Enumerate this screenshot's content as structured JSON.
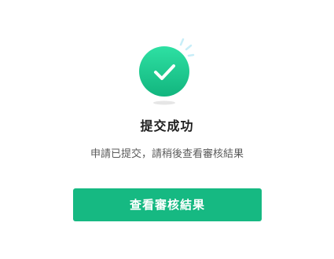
{
  "result": {
    "icon": "check-circle-icon",
    "title": "提交成功",
    "message": "申請已提交，請稍後查看審核結果",
    "button_label": "查看審核結果"
  },
  "colors": {
    "accent": "#16b982",
    "accent_light": "#2ee0a3",
    "sparkle": "#c8eef8",
    "shadow": "#e6e6e6"
  }
}
